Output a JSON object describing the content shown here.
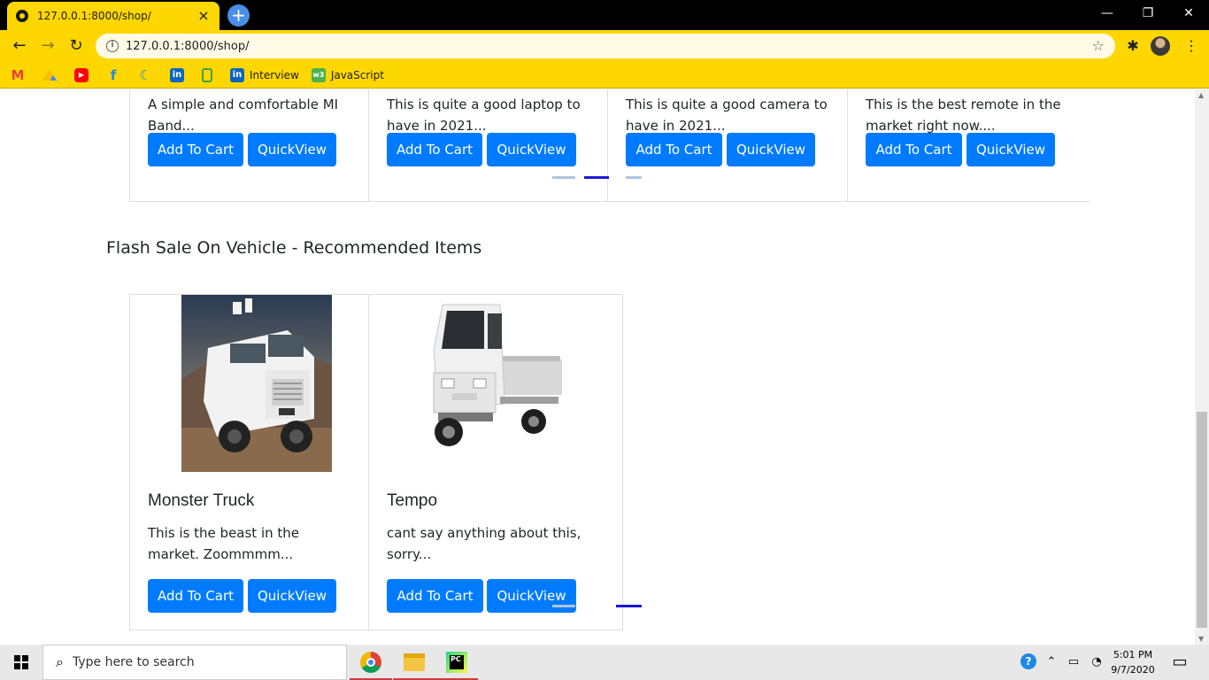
{
  "browser": {
    "tab_title": "127.0.0.1:8000/shop/",
    "url": "127.0.0.1:8000/shop/",
    "bookmarks": [
      {
        "icon": "gmail-icon",
        "label": "",
        "color": "#EA4335"
      },
      {
        "icon": "drive-icon",
        "label": "",
        "color": "#34A853"
      },
      {
        "icon": "youtube-icon",
        "label": "",
        "color": "#FF0000"
      },
      {
        "icon": "bookmark-icon",
        "label": "",
        "color": "#1E88E5"
      },
      {
        "icon": "moon-icon",
        "label": "",
        "color": "#1E88E5"
      },
      {
        "icon": "linkedin-icon",
        "label": "",
        "color": "#0A66C2"
      },
      {
        "icon": "bookmark-icon",
        "label": "",
        "color": "#43A047"
      },
      {
        "icon": "linkedin-icon",
        "label": "Interview",
        "color": "#0A66C2"
      },
      {
        "icon": "w3-icon",
        "label": "JavaScript",
        "color": "#4CAF50"
      }
    ]
  },
  "top_row": [
    {
      "desc": "A simple and comfortable MI Band...",
      "add": "Add To Cart",
      "view": "QuickView"
    },
    {
      "desc": "This is quite a good laptop to have in 2021...",
      "add": "Add To Cart",
      "view": "QuickView"
    },
    {
      "desc": "This is quite a good camera to have in 2021...",
      "add": "Add To Cart",
      "view": "QuickView"
    },
    {
      "desc": "This is the best remote in the market right now....",
      "add": "Add To Cart",
      "view": "QuickView"
    }
  ],
  "section": {
    "title": "Flash Sale On Vehicle - Recommended Items"
  },
  "vehicles": [
    {
      "name": "Monster Truck",
      "desc": "This is the beast in the market. Zoommmm...",
      "add": "Add To Cart",
      "view": "QuickView"
    },
    {
      "name": "Tempo",
      "desc": "cant say anything about this, sorry...",
      "add": "Add To Cart",
      "view": "QuickView"
    }
  ],
  "taskbar": {
    "search_placeholder": "Type here to search",
    "time": "5:01 PM",
    "date": "9/7/2020"
  },
  "colors": {
    "chrome_theme": "#FFD700",
    "button": "#007BFF"
  }
}
